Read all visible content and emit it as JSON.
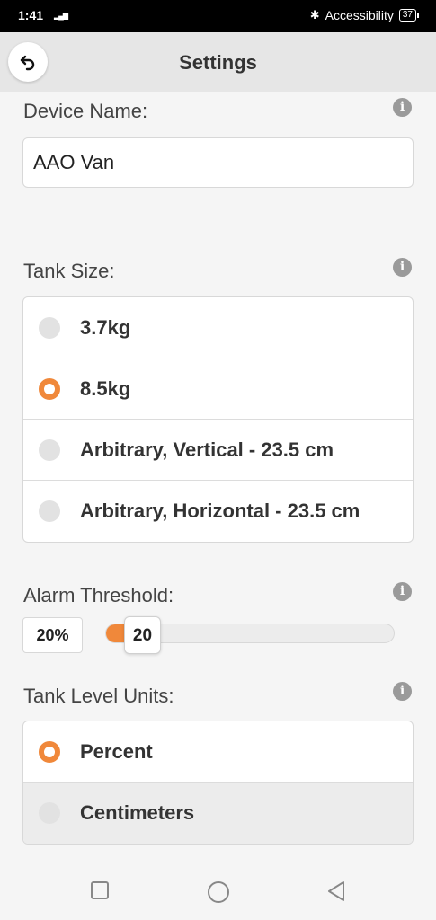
{
  "status_bar": {
    "time": "1:41",
    "signal": "4G",
    "accessibility": "Accessibility",
    "battery": "37"
  },
  "header": {
    "title": "Settings",
    "back_icon": "back-arrow-icon"
  },
  "device_name": {
    "label": "Device Name:",
    "value": "AAO Van"
  },
  "tank_size": {
    "label": "Tank Size:",
    "options": [
      {
        "label": "3.7kg",
        "selected": false
      },
      {
        "label": "8.5kg",
        "selected": true
      },
      {
        "label": "Arbitrary, Vertical - 23.5 cm",
        "selected": false
      },
      {
        "label": "Arbitrary, Horizontal - 23.5 cm",
        "selected": false
      }
    ]
  },
  "alarm_threshold": {
    "label": "Alarm Threshold:",
    "value_display": "20%",
    "slider_value": "20",
    "slider_level": 0.2
  },
  "tank_level_units": {
    "label": "Tank Level Units:",
    "options": [
      {
        "label": "Percent",
        "selected": true
      },
      {
        "label": "Centimeters",
        "selected": false
      }
    ]
  },
  "info_icon_glyph": "i",
  "colors": {
    "accent": "#f0883a",
    "header_bg": "#e6e6e6",
    "page_bg": "#f5f5f5"
  }
}
